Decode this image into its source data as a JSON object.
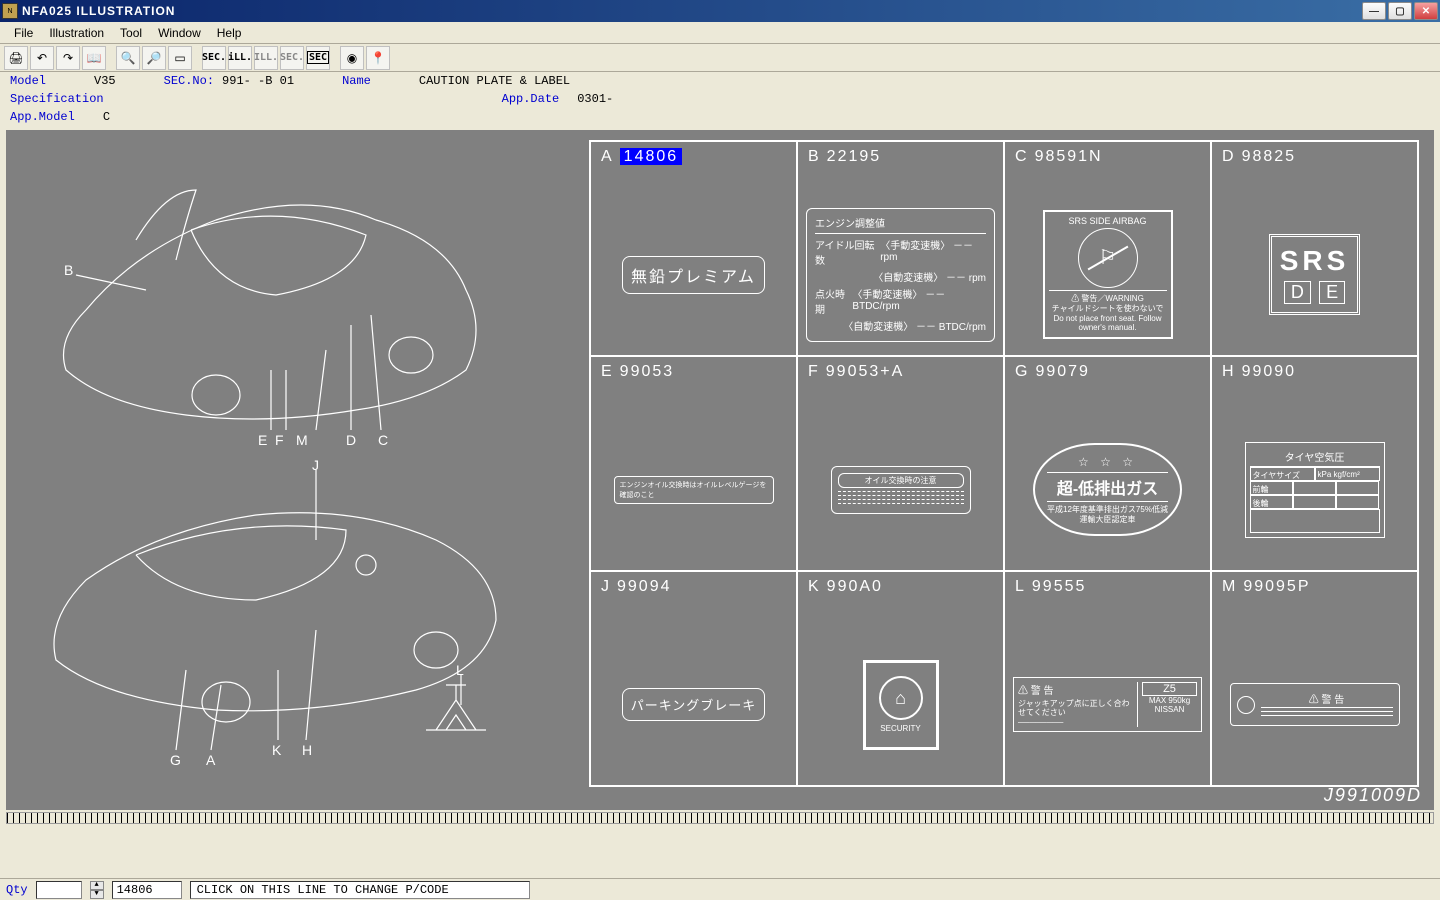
{
  "window": {
    "title": "NFA025  ILLUSTRATION",
    "icon_text": "N"
  },
  "menu": {
    "file": "File",
    "illustration": "Illustration",
    "tool": "Tool",
    "window": "Window",
    "help": "Help"
  },
  "toolbar": {
    "print": "🖨",
    "undo": "↶",
    "redo": "↷",
    "book": "📖",
    "search": "🔍",
    "zoom": "🔎",
    "fit": "▭",
    "sec_dark": "SEC.",
    "ill_light": "iLL.",
    "ill_gray": "ILL.",
    "sec_gray": "SEC.",
    "sec_box": "SEC",
    "globe": "◉",
    "pin": "📍"
  },
  "info": {
    "model_label": "Model",
    "model_val": "V35",
    "secno_label": "SEC.No:",
    "secno_val": "991-  -B 01",
    "name_label": "Name",
    "name_val": "CAUTION PLATE & LABEL",
    "spec_label": "Specification",
    "appdate_label": "App.Date",
    "appdate_val": "0301-",
    "appmodel_label": "App.Model",
    "appmodel_val": "C"
  },
  "diagram": {
    "callouts_top": [
      "B",
      "M",
      "D",
      "C",
      "E",
      "F"
    ],
    "callouts_bot": [
      "J",
      "H",
      "K",
      "G",
      "A",
      "L"
    ],
    "drawing_id": "J991009D"
  },
  "cells": {
    "A": {
      "ltr": "A",
      "code": "14806",
      "highlighted": true,
      "plate_text": "無鉛プレミアム"
    },
    "B": {
      "ltr": "B",
      "code": "22195",
      "engine": {
        "title": "エンジン調整値",
        "r1l": "アイドル回転数",
        "r1a": "〈手動変速機〉 －－ rpm",
        "r1b": "〈自動変速機〉 －－ rpm",
        "r2l": "点火時期",
        "r2a": "〈手動変速機〉 －－ BTDC/rpm",
        "r2b": "〈自動変速機〉 －－ BTDC/rpm"
      }
    },
    "C": {
      "ltr": "C",
      "code": "98591N",
      "srs_title": "SRS SIDE AIRBAG",
      "srs_warn": "⚠ 警告／WARNING",
      "srs_fine1": "チャイルドシートを使わないで",
      "srs_fine2": "Do not place front seat. Follow owner's manual."
    },
    "D": {
      "ltr": "D",
      "code": "98825",
      "srs_big": "SRS",
      "srs_d": "D",
      "srs_e": "E"
    },
    "E": {
      "ltr": "E",
      "code": "99053",
      "plate_sm": "エンジンオイル交換時はオイルレベルゲージを確認のこと"
    },
    "F": {
      "ltr": "F",
      "code": "99053+A",
      "plate_t": "オイル交換時の注意"
    },
    "G": {
      "ltr": "G",
      "code": "99079",
      "oval_main": "超-低排出ガス",
      "oval_sub1": "平成12年度基準排出ガス75%低減",
      "oval_sub2": "運輸大臣認定車"
    },
    "H": {
      "ltr": "H",
      "code": "99090",
      "tire_title": "タイヤ空気圧",
      "tire_h1": "タイヤサイズ",
      "tire_h2": "kPa kgf/cm²",
      "tire_r1": "前輪",
      "tire_r2": "後輪"
    },
    "J": {
      "ltr": "J",
      "code": "99094",
      "plate_text": "パーキングブレーキ"
    },
    "K": {
      "ltr": "K",
      "code": "990A0",
      "sec_text": "SECURITY"
    },
    "L": {
      "ltr": "L",
      "code": "99555",
      "warn": "⚠ 警 告",
      "z5": "Z5",
      "max": "MAX 950kg",
      "brand": "NISSAN",
      "fine": "ジャッキアップ点に正しく合わせてください"
    },
    "M": {
      "ltr": "M",
      "code": "99095P",
      "warn": "⚠   警   告"
    }
  },
  "status": {
    "qty_label": "Qty",
    "code": "14806",
    "msg": "CLICK ON THIS LINE TO CHANGE P/CODE"
  }
}
